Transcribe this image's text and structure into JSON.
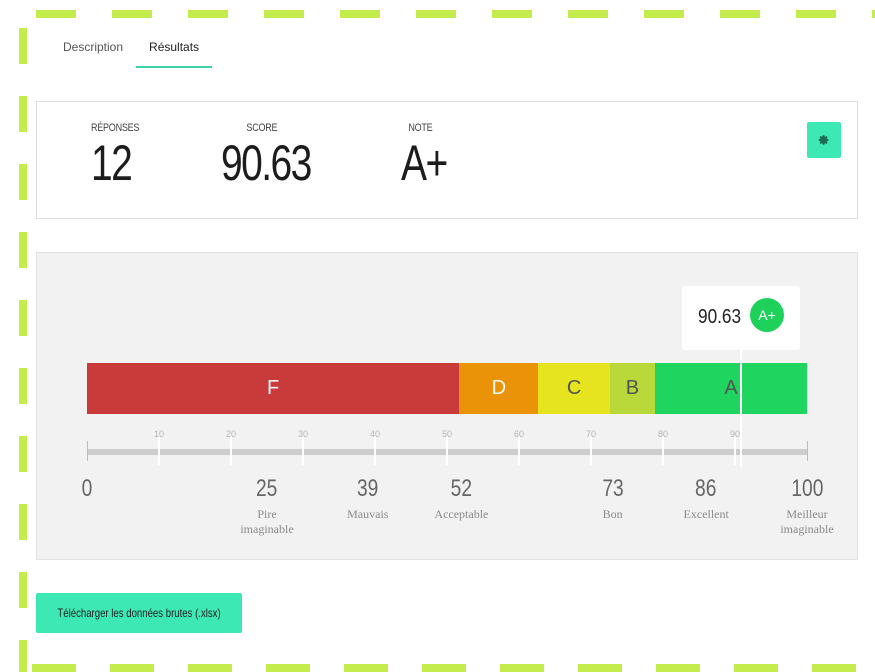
{
  "tabs": [
    {
      "label": "Description",
      "active": false
    },
    {
      "label": "Résultats",
      "active": true
    }
  ],
  "summary": {
    "responses_label": "RÉPONSES",
    "responses_value": "12",
    "score_label": "SCORE",
    "score_value": "90.63",
    "grade_label": "NOTE",
    "grade_value": "A+",
    "settings_icon": "gear-icon"
  },
  "gauge": {
    "score": 90.63,
    "callout_value": "90.63",
    "callout_grade": "A+",
    "grades": [
      {
        "label": "F",
        "from": 0,
        "to": 51.7,
        "color": "#c93b3b"
      },
      {
        "label": "D",
        "from": 51.7,
        "to": 62.7,
        "color": "#ea9309"
      },
      {
        "label": "C",
        "from": 62.7,
        "to": 72.6,
        "color": "#e6e31f"
      },
      {
        "label": "B",
        "from": 72.6,
        "to": 78.9,
        "color": "#b9d83a"
      },
      {
        "label": "A",
        "from": 78.9,
        "to": 100,
        "color": "#1fd45f"
      }
    ],
    "minor_ticks": [
      "10",
      "20",
      "30",
      "40",
      "50",
      "60",
      "70",
      "80",
      "90"
    ],
    "references": [
      {
        "value": "0",
        "label": ""
      },
      {
        "value": "25",
        "label": "Pire\nimaginable"
      },
      {
        "value": "39",
        "label": "Mauvais"
      },
      {
        "value": "52",
        "label": "Acceptable"
      },
      {
        "value": "73",
        "label": "Bon"
      },
      {
        "value": "86",
        "label": "Excellent"
      },
      {
        "value": "100",
        "label": "Meilleur\nimaginable"
      }
    ]
  },
  "download_label": "Télécharger les données brutes (.xlsx)",
  "colors": {
    "accent": "#3ee8b4",
    "tab_underline": "#3ad4a8",
    "badge": "#1ed15b"
  }
}
